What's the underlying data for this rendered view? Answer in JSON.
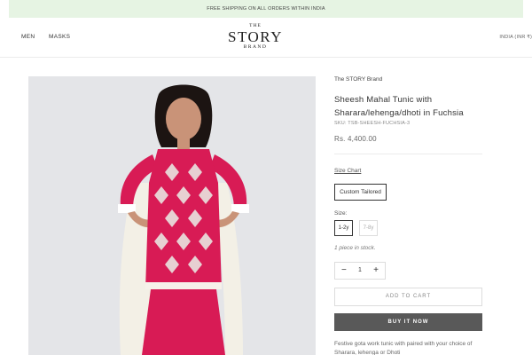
{
  "announcement": {
    "text": "FREE SHIPPING ON ALL ORDERS WITHIN INDIA"
  },
  "header": {
    "nav": [
      {
        "label": "MEN"
      },
      {
        "label": "MASKS"
      }
    ],
    "logo": {
      "top": "THE",
      "main": "STORY",
      "bottom": "BRAND"
    },
    "locale": "INDIA (INR ₹)"
  },
  "product": {
    "image_alt": "Girl wearing fuchsia sheesh mahal tunic with sharara and off-white dupatta",
    "vendor": "The STORY Brand",
    "title": "Sheesh Mahal Tunic with Sharara/lehenga/dhoti in Fuchsia",
    "sku": "SKU: TSB-SHEESH-FUCHSIA-3",
    "price": "Rs. 4,400.00",
    "size_chart_label": "Size Chart",
    "custom_option": "Custom Tailored",
    "size_label": "Size:",
    "sizes": [
      {
        "label": "1-2y"
      },
      {
        "label": "7-8y"
      }
    ],
    "stock": "1 piece in stock.",
    "quantity": {
      "minus": "−",
      "value": "1",
      "plus": "+"
    },
    "add_to_cart": "ADD TO CART",
    "buy_now": "BUY IT NOW",
    "description": "Festive gota work tunic with paired with your choice of Sharara, lehenga or Dhoti"
  },
  "colors": {
    "announcement_bg": "#e6f4e3",
    "buy_now_bg": "#595959",
    "fuchsia": "#d81b55",
    "image_bg": "#e4e5e8"
  }
}
